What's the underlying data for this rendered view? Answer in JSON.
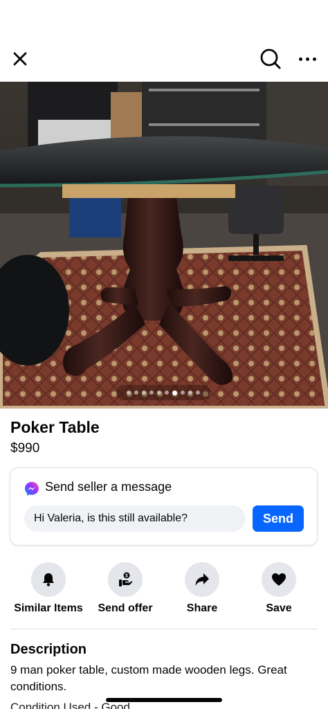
{
  "header": {
    "close_icon": "close-icon",
    "search_icon": "search-icon",
    "more_icon": "more-horizontal-icon"
  },
  "gallery": {
    "image_count": 10,
    "active_index": 6,
    "image_subject": "dark wooden pedestal poker table on a patterned rug"
  },
  "listing": {
    "title": "Poker Table",
    "price": "$990"
  },
  "message": {
    "heading": "Send seller a message",
    "input_value": "Hi Valeria, is this still available?",
    "send_label": "Send",
    "accent_color": "#0866ff"
  },
  "actions": [
    {
      "label": "Similar Items",
      "icon": "bell-icon"
    },
    {
      "label": "Send offer",
      "icon": "offer-icon"
    },
    {
      "label": "Share",
      "icon": "share-icon"
    },
    {
      "label": "Save",
      "icon": "heart-icon"
    }
  ],
  "description": {
    "heading": "Description",
    "text": "9 man poker table, custom made wooden legs. Great conditions.",
    "cutoff_text": "Condition                    Used - Good"
  }
}
